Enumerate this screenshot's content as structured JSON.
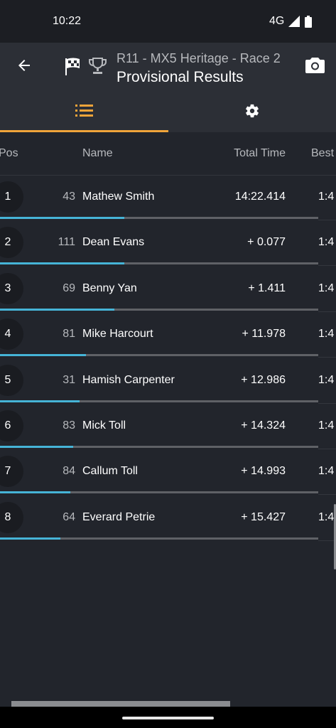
{
  "status_bar": {
    "time": "10:22",
    "network": "4G",
    "icons": [
      "signal-icon",
      "battery-icon"
    ]
  },
  "app_bar": {
    "subtitle": "R11 - MX5 Heritage - Race 2",
    "title": "Provisional Results",
    "icons": [
      "back-arrow-icon",
      "checkered-flag-icon",
      "trophy-icon",
      "camera-icon"
    ]
  },
  "tabs": [
    {
      "icon": "list-icon",
      "active": true
    },
    {
      "icon": "gear-icon",
      "active": false
    }
  ],
  "colors": {
    "background": "#22252c",
    "app_bar": "#2c2f36",
    "accent": "#f0a43a",
    "progress": "#46b4d7",
    "muted_text": "#b7b9bd"
  },
  "table": {
    "headers": {
      "pos": "Pos",
      "name": "Name",
      "total_time": "Total Time",
      "best": "Best"
    },
    "rows": [
      {
        "pos": "1",
        "number": "43",
        "name": "Mathew Smith",
        "total_time": "14:22.414",
        "best": "1:4",
        "progress": 0.39
      },
      {
        "pos": "2",
        "number": "111",
        "name": "Dean Evans",
        "total_time": "+ 0.077",
        "best": "1:4",
        "progress": 0.39
      },
      {
        "pos": "3",
        "number": "69",
        "name": "Benny Yan",
        "total_time": "+ 1.411",
        "best": "1:4",
        "progress": 0.36
      },
      {
        "pos": "4",
        "number": "81",
        "name": "Mike Harcourt",
        "total_time": "+ 11.978",
        "best": "1:4",
        "progress": 0.27
      },
      {
        "pos": "5",
        "number": "31",
        "name": "Hamish Carpenter",
        "total_time": "+ 12.986",
        "best": "1:4",
        "progress": 0.25
      },
      {
        "pos": "6",
        "number": "83",
        "name": "Mick Toll",
        "total_time": "+ 14.324",
        "best": "1:4",
        "progress": 0.23
      },
      {
        "pos": "7",
        "number": "84",
        "name": "Callum Toll",
        "total_time": "+ 14.993",
        "best": "1:4",
        "progress": 0.22
      },
      {
        "pos": "8",
        "number": "64",
        "name": "Everard Petrie",
        "total_time": "+ 15.427",
        "best": "1:4",
        "progress": 0.19
      }
    ]
  }
}
